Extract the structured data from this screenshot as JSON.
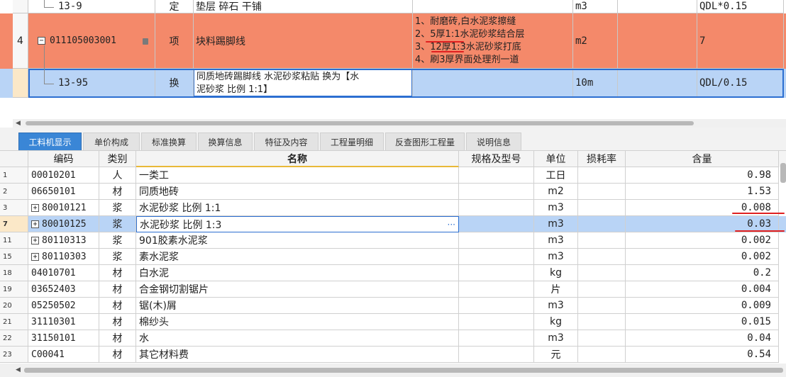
{
  "upper": {
    "row_top": {
      "code": "13-9",
      "type": "定",
      "name": "垫层 碎石 干铺",
      "unit": "m3",
      "qty_expr": "QDL*0.15"
    },
    "row_main": {
      "row_num": "4",
      "code": "011105003001",
      "type": "项",
      "name": "块料踢脚线",
      "features": [
        "1、耐磨砖,白水泥浆擦缝",
        "2、5厚1:1水泥砂浆结合层",
        "3、12厚1:3水泥砂浆打底",
        "4、刷3厚界面处理剂一道"
      ],
      "unit": "m2",
      "qty_expr": "7"
    },
    "row_sub": {
      "code": "13-95",
      "type": "换",
      "name_line1": "同质地砖踢脚线 水泥砂浆粘贴  换为【水",
      "name_line2": "泥砂浆 比例 1:1】",
      "unit": "10m",
      "qty_expr": "QDL/0.15"
    },
    "colors": {
      "main_row_bg": "#f4896a",
      "selected_bg": "#b9d4f6",
      "accent": "#2c6fd1"
    }
  },
  "tabs": [
    {
      "label": "工料机显示",
      "active": true
    },
    {
      "label": "单价构成",
      "active": false
    },
    {
      "label": "标准换算",
      "active": false
    },
    {
      "label": "换算信息",
      "active": false
    },
    {
      "label": "特征及内容",
      "active": false
    },
    {
      "label": "工程量明细",
      "active": false
    },
    {
      "label": "反查图形工程量",
      "active": false
    },
    {
      "label": "说明信息",
      "active": false
    }
  ],
  "lower": {
    "headers": {
      "code": "编码",
      "type": "类别",
      "name": "名称",
      "spec": "规格及型号",
      "unit": "单位",
      "loss": "损耗率",
      "amount": "含量"
    },
    "rows": [
      {
        "num": "1",
        "code": "00010201",
        "type": "人",
        "name": "一类工",
        "unit": "工日",
        "amount": "0.98",
        "expand": false,
        "selected": false
      },
      {
        "num": "2",
        "code": "06650101",
        "type": "材",
        "name": "同质地砖",
        "unit": "m2",
        "amount": "1.53",
        "expand": false,
        "selected": false
      },
      {
        "num": "3",
        "code": "80010121",
        "type": "浆",
        "name": "水泥砂浆 比例 1:1",
        "unit": "m3",
        "amount": "0.008",
        "expand": true,
        "selected": false
      },
      {
        "num": "7",
        "code": "80010125",
        "type": "浆",
        "name": "水泥砂浆 比例 1:3",
        "unit": "m3",
        "amount": "0.03",
        "expand": true,
        "selected": true
      },
      {
        "num": "11",
        "code": "80110313",
        "type": "浆",
        "name": "901胶素水泥浆",
        "unit": "m3",
        "amount": "0.002",
        "expand": true,
        "selected": false
      },
      {
        "num": "15",
        "code": "80110303",
        "type": "浆",
        "name": "素水泥浆",
        "unit": "m3",
        "amount": "0.002",
        "expand": true,
        "selected": false
      },
      {
        "num": "18",
        "code": "04010701",
        "type": "材",
        "name": "白水泥",
        "unit": "kg",
        "amount": "0.2",
        "expand": false,
        "selected": false
      },
      {
        "num": "19",
        "code": "03652403",
        "type": "材",
        "name": "合金钢切割锯片",
        "unit": "片",
        "amount": "0.004",
        "expand": false,
        "selected": false
      },
      {
        "num": "20",
        "code": "05250502",
        "type": "材",
        "name": "锯(木)屑",
        "unit": "m3",
        "amount": "0.009",
        "expand": false,
        "selected": false
      },
      {
        "num": "21",
        "code": "31110301",
        "type": "材",
        "name": "棉纱头",
        "unit": "kg",
        "amount": "0.015",
        "expand": false,
        "selected": false
      },
      {
        "num": "22",
        "code": "31150101",
        "type": "材",
        "name": "水",
        "unit": "m3",
        "amount": "0.04",
        "expand": false,
        "selected": false
      },
      {
        "num": "23",
        "code": "C00041",
        "type": "材",
        "name": "其它材料费",
        "unit": "元",
        "amount": "0.54",
        "expand": false,
        "selected": false
      }
    ],
    "ellipsis": "···"
  },
  "icons": {
    "collapse": "minus-box-icon",
    "expand": "plus-box-icon",
    "lock": "lock-icon"
  }
}
